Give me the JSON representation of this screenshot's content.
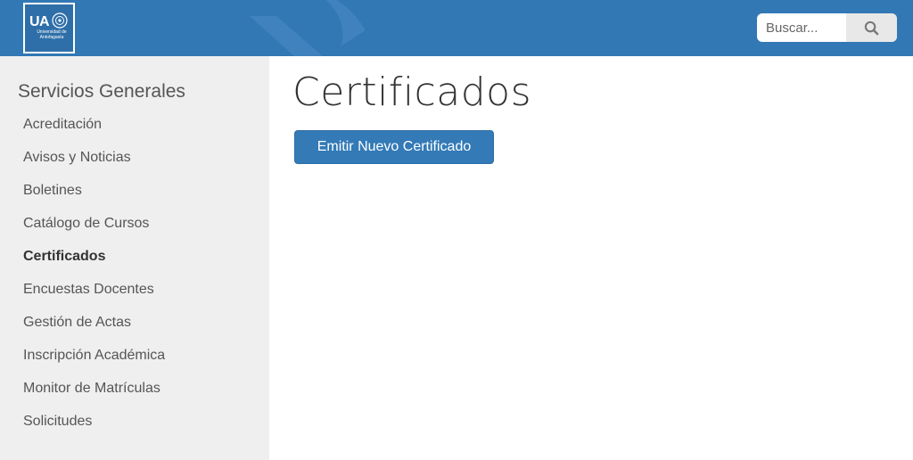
{
  "header": {
    "logo": {
      "mark": "UA",
      "subtitle": "Universidad de Antofagasta",
      "emblem": "seal-icon"
    },
    "search": {
      "placeholder": "Buscar...",
      "icon": "search-icon"
    },
    "colors": {
      "bar": "#3178b5",
      "watermark": "#4a8ac4"
    }
  },
  "sidebar": {
    "heading": "Servicios Generales",
    "items": [
      {
        "label": "Acreditación",
        "active": false
      },
      {
        "label": "Avisos y Noticias",
        "active": false
      },
      {
        "label": "Boletines",
        "active": false
      },
      {
        "label": "Catálogo de Cursos",
        "active": false
      },
      {
        "label": "Certificados",
        "active": true
      },
      {
        "label": "Encuestas Docentes",
        "active": false
      },
      {
        "label": "Gestión de Actas",
        "active": false
      },
      {
        "label": "Inscripción Académica",
        "active": false
      },
      {
        "label": "Monitor de Matrículas",
        "active": false
      },
      {
        "label": "Solicitudes",
        "active": false
      }
    ],
    "background": "#efefef"
  },
  "main": {
    "title": "Certificados",
    "primary_button": "Emitir Nuevo Certificado",
    "button_color": "#337ab7"
  }
}
